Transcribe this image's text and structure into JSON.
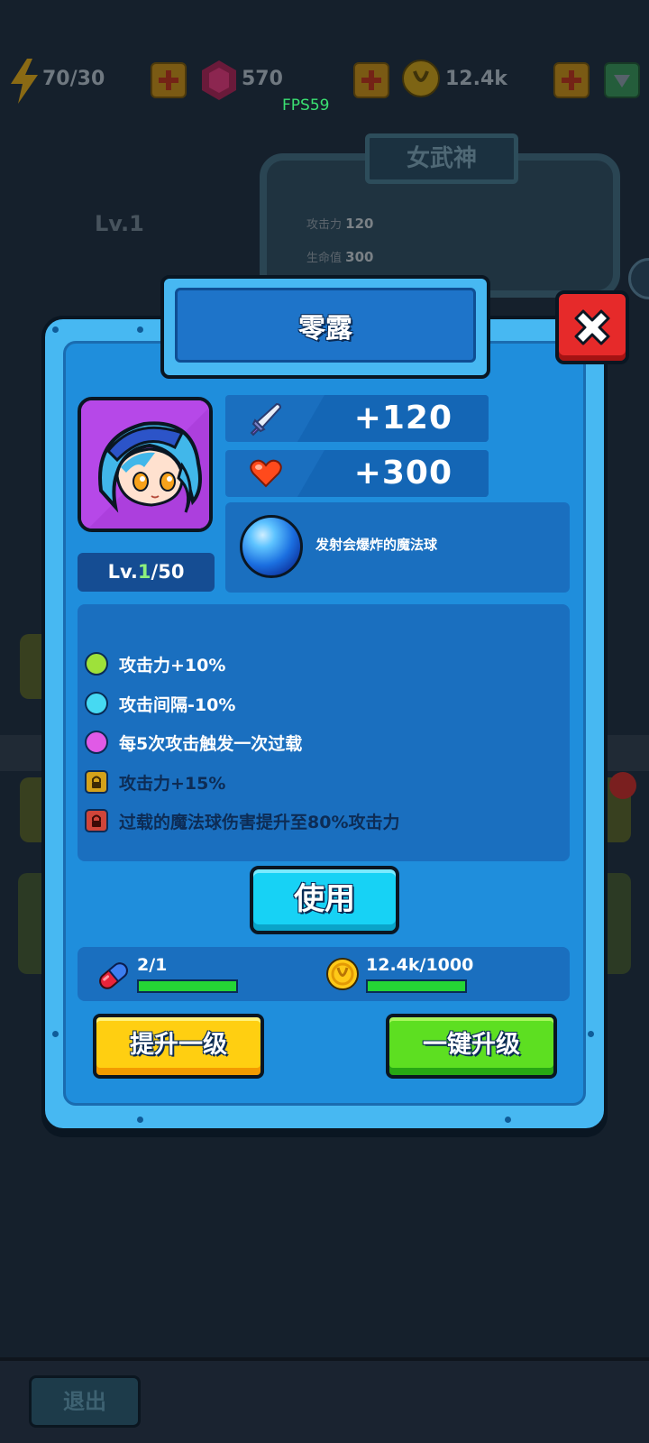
{
  "top_bar": {
    "energy": "70/30",
    "gems": "570",
    "coins": "12.4k",
    "fps": "FPS59"
  },
  "background": {
    "hero_title": "女武神",
    "level": "Lv.1",
    "attack_label": "攻击力",
    "attack_value": "120",
    "hp_label": "生命值",
    "hp_value": "300",
    "exit_label": "退出"
  },
  "popup": {
    "title": "零露",
    "attack_bonus": "+120",
    "hp_bonus": "+300",
    "skill_description": "发射会爆炸的魔法球",
    "level": {
      "prefix": "Lv.",
      "current": "1",
      "max": "/50"
    },
    "perks": [
      {
        "text": "攻击力+10%",
        "color": "#9ee13a",
        "locked": false
      },
      {
        "text": "攻击间隔-10%",
        "color": "#46d9f2",
        "locked": false
      },
      {
        "text": "每5次攻击触发一次过载",
        "color": "#e05ae6",
        "locked": false
      },
      {
        "text": "攻击力+15%",
        "color": "#d4a21a",
        "locked": true
      },
      {
        "text": "过载的魔法球伤害提升至80%攻击力",
        "color": "#d0453a",
        "locked": true
      }
    ],
    "use_button": "使用",
    "cost": {
      "pills": "2/1",
      "pills_progress": 1.0,
      "coins": "12.4k/1000",
      "coins_progress": 1.0
    },
    "upgrade_one_button": "提升一级",
    "upgrade_all_button": "一键升级"
  },
  "colors": {
    "popup_frame": "#47b8f2",
    "popup_body": "#1f8edc",
    "close_red": "#e62a2a",
    "use_cyan": "#17d2f5",
    "upgrade_yellow": "#ffcf11",
    "upgrade_green": "#5ddf21"
  }
}
